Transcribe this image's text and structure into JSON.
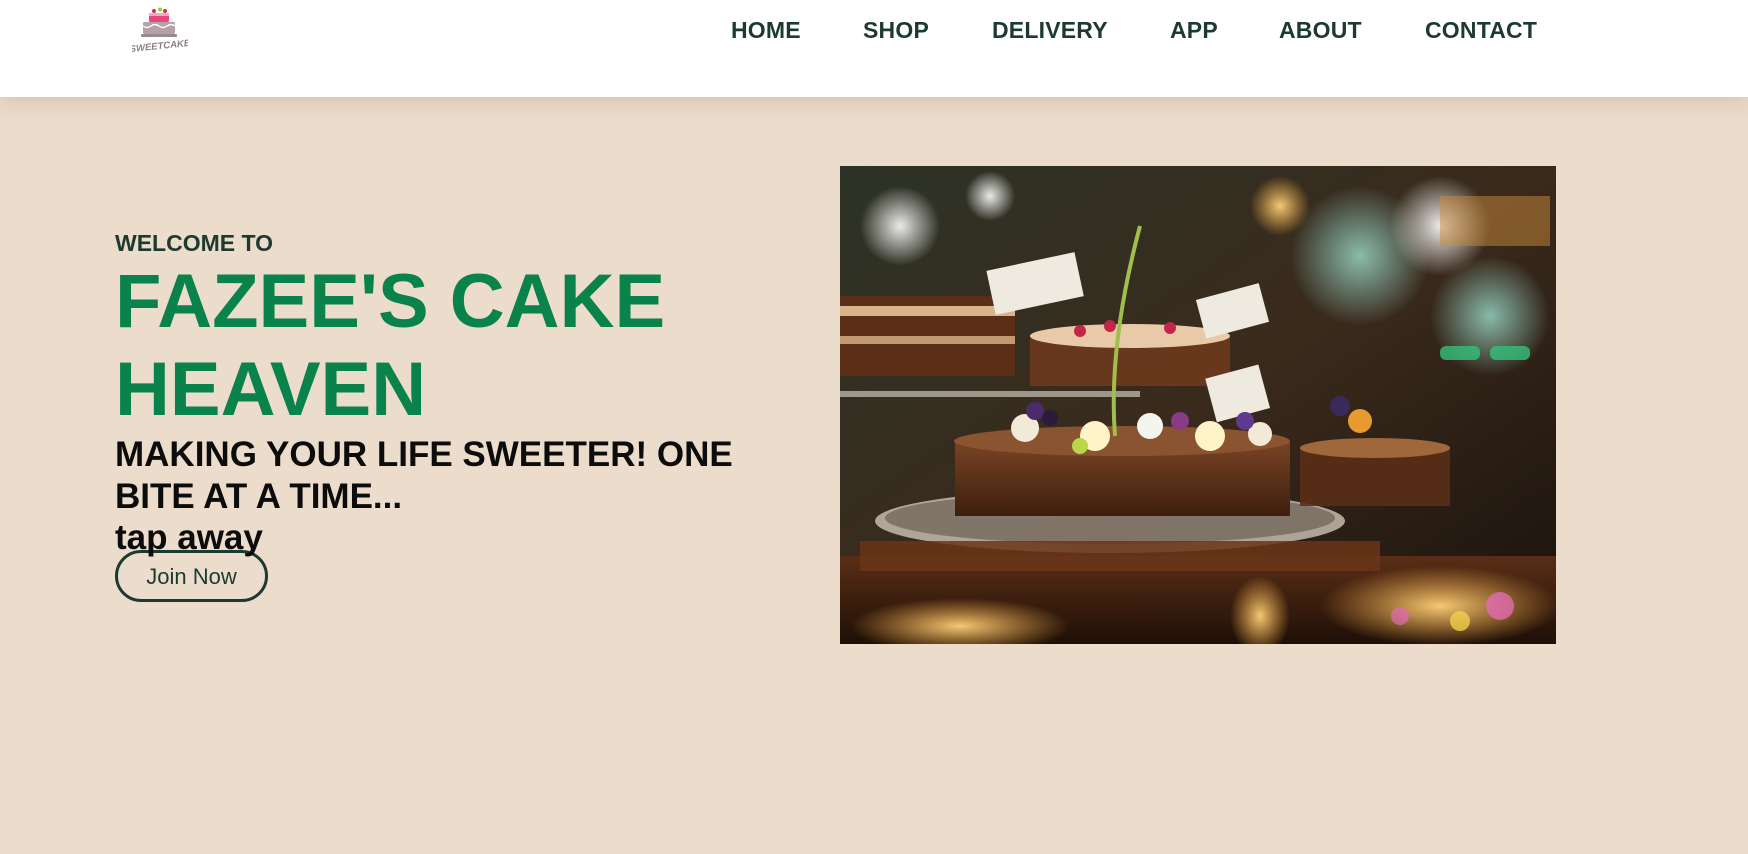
{
  "header": {
    "logo_text": "SWEETCAKE"
  },
  "nav": {
    "items": [
      {
        "label": "HOME",
        "name": "nav-home"
      },
      {
        "label": "SHOP",
        "name": "nav-shop"
      },
      {
        "label": "DELIVERY",
        "name": "nav-delivery"
      },
      {
        "label": "APP",
        "name": "nav-app"
      },
      {
        "label": "ABOUT",
        "name": "nav-about"
      },
      {
        "label": "CONTACT",
        "name": "nav-contact"
      }
    ]
  },
  "hero": {
    "welcome": "WELCOME TO",
    "title_line1": "FAZEE'S CAKE",
    "title_line2": "HEAVEN",
    "tagline_line1": "MAKING YOUR LIFE SWEETER! ONE",
    "tagline_line2": "BITE AT A TIME...",
    "tap_away": "tap away",
    "join_button": "Join Now"
  },
  "colors": {
    "background": "#ebdccb",
    "header": "#ffffff",
    "nav_text": "#1c3a2e",
    "title": "#0a824c",
    "tagline": "#0c0c0c"
  }
}
